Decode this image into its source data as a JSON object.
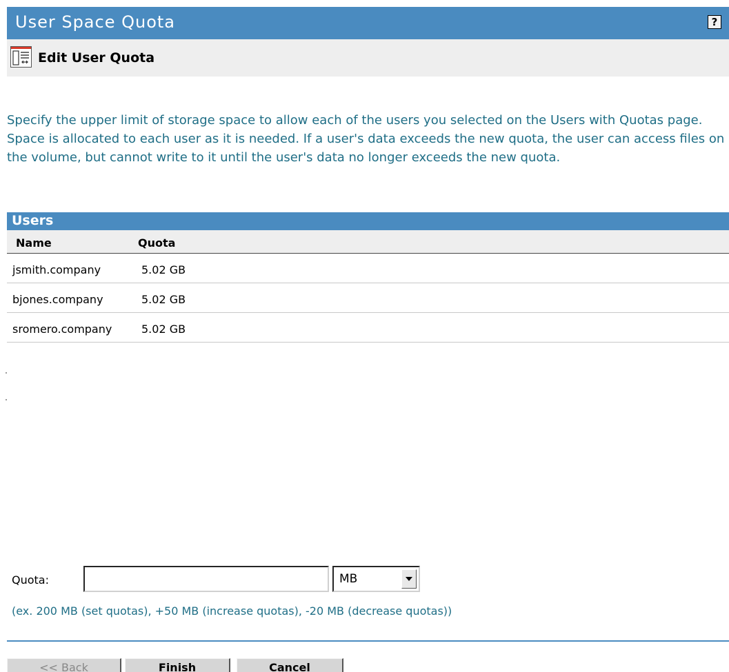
{
  "header": {
    "title": "User Space Quota",
    "help_icon": "help-question-icon",
    "help_label": "?"
  },
  "subheader": {
    "icon": "edit-document-icon",
    "title": "Edit User Quota"
  },
  "description": "Specify the upper limit of storage space to allow each of the users you selected on the Users with Quotas page. Space is allocated to each user as it is needed. If a user's data exceeds the new quota, the user can access files on the volume, but cannot write to it until the user's data no longer exceeds the new quota.",
  "users_table": {
    "title": "Users",
    "columns": [
      "Name",
      "Quota"
    ],
    "rows": [
      {
        "name": "jsmith.company",
        "quota": "5.02 GB"
      },
      {
        "name": "bjones.company",
        "quota": "5.02 GB"
      },
      {
        "name": "sromero.company",
        "quota": "5.02 GB"
      }
    ]
  },
  "quota_form": {
    "label": "Quota:",
    "input_value": "",
    "unit_selected": "MB",
    "hint": "(ex. 200 MB (set quotas), +50 MB (increase quotas), -20 MB (decrease quotas))"
  },
  "buttons": {
    "back": "<< Back",
    "finish": "Finish",
    "cancel": "Cancel"
  },
  "colors": {
    "accent": "#4a8bc0",
    "text_teal": "#1f6e86",
    "strip_gray": "#eeeeee"
  }
}
